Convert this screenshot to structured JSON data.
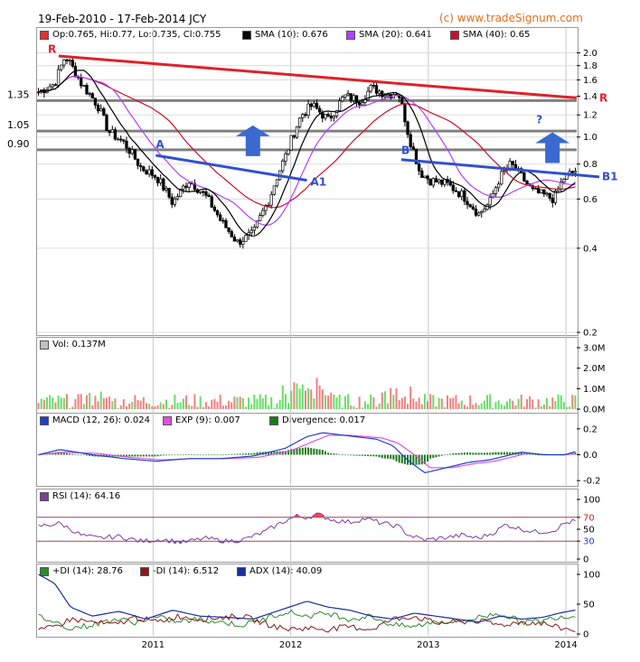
{
  "header": {
    "range_title": "19-Feb-2010 - 17-Feb-2014 JCY",
    "credit": "(c) www.tradeSignum.com"
  },
  "colors": {
    "ohlc_swatch": "#e03030",
    "sma10": "#000000",
    "sma20": "#b040ff",
    "sma40": "#c8102e",
    "volume_up": "#66dd66",
    "volume_down": "#f08080",
    "macd": "#1f3fd0",
    "exp": "#e050e0",
    "divergence": "#1a7a1a",
    "rsi": "#7b3fa0",
    "pdi": "#2e8b2e",
    "mdi": "#8b1a1a",
    "adx": "#1a2e9b",
    "trend_red": "#e0202a",
    "trend_blue": "#3050d0",
    "support_grey": "#808080",
    "arrow_blue": "#3a6ad0"
  },
  "chart_data": [
    {
      "type": "candlestick",
      "panel": "price",
      "legend": {
        "ohlc": "Op:0.765, Hi:0.77, Lo:0.735, Cl:0.755",
        "sma10": "SMA (10): 0.676",
        "sma20": "SMA (20): 0.641",
        "sma40": "SMA (40): 0.65"
      },
      "scale": "log",
      "ylim": [
        0.2,
        2.1
      ],
      "y_ticks": [
        "2.0",
        "1.8",
        "1.6",
        "1.4",
        "1.2",
        "1.0",
        "0.8",
        "0.6",
        "0.4",
        "0.2"
      ],
      "y_tick_values": [
        2.0,
        1.8,
        1.6,
        1.4,
        1.2,
        1.0,
        0.8,
        0.6,
        0.4,
        0.2
      ],
      "x_ticks": [
        "2011",
        "2012",
        "2013",
        "2014"
      ],
      "x_tick_positions": [
        0.215,
        0.47,
        0.725,
        0.98
      ],
      "left_levels": [
        {
          "label": "1.35",
          "value": 1.35
        },
        {
          "label": "1.05",
          "value": 1.05
        },
        {
          "label": "0.90",
          "value": 0.9
        }
      ],
      "trendline_labels": {
        "red_start": "R",
        "red_end": "R",
        "blue1_start": "A",
        "blue1_end": "A1",
        "blue2_start": "B",
        "blue2_end": "B1",
        "question": "?"
      },
      "close_anchors": [
        [
          0.0,
          1.45
        ],
        [
          0.03,
          1.55
        ],
        [
          0.05,
          1.95
        ],
        [
          0.08,
          1.55
        ],
        [
          0.11,
          1.3
        ],
        [
          0.13,
          1.05
        ],
        [
          0.16,
          0.95
        ],
        [
          0.19,
          0.78
        ],
        [
          0.22,
          0.72
        ],
        [
          0.25,
          0.58
        ],
        [
          0.28,
          0.7
        ],
        [
          0.31,
          0.62
        ],
        [
          0.34,
          0.5
        ],
        [
          0.37,
          0.42
        ],
        [
          0.4,
          0.45
        ],
        [
          0.43,
          0.6
        ],
        [
          0.46,
          0.85
        ],
        [
          0.49,
          1.2
        ],
        [
          0.51,
          1.3
        ],
        [
          0.54,
          1.15
        ],
        [
          0.57,
          1.4
        ],
        [
          0.6,
          1.35
        ],
        [
          0.62,
          1.5
        ],
        [
          0.65,
          1.42
        ],
        [
          0.67,
          1.45
        ],
        [
          0.69,
          1.0
        ],
        [
          0.71,
          0.75
        ],
        [
          0.73,
          0.7
        ],
        [
          0.76,
          0.68
        ],
        [
          0.79,
          0.62
        ],
        [
          0.82,
          0.53
        ],
        [
          0.84,
          0.58
        ],
        [
          0.86,
          0.72
        ],
        [
          0.88,
          0.8
        ],
        [
          0.9,
          0.72
        ],
        [
          0.92,
          0.64
        ],
        [
          0.94,
          0.62
        ],
        [
          0.96,
          0.6
        ],
        [
          0.98,
          0.72
        ],
        [
          1.0,
          0.755
        ]
      ]
    },
    {
      "type": "bar",
      "panel": "volume",
      "legend": "Vol: 0.137M",
      "ylim": [
        0,
        3.0
      ],
      "y_ticks": [
        "3.0M",
        "2.0M",
        "1.0M",
        "0.0M"
      ],
      "y_tick_values": [
        3.0,
        2.0,
        1.0,
        0.0
      ]
    },
    {
      "type": "line",
      "panel": "macd",
      "legend": {
        "macd": "MACD (12, 26): 0.024",
        "exp": "EXP (9): 0.007",
        "divergence": "Divergence: 0.017"
      },
      "ylim": [
        -0.22,
        0.22
      ],
      "y_ticks": [
        "0.2",
        "0.0",
        "-0.2"
      ],
      "y_tick_values": [
        0.2,
        0.0,
        -0.2
      ],
      "macd_anchors": [
        [
          0.0,
          0.0
        ],
        [
          0.04,
          0.04
        ],
        [
          0.1,
          0.0
        ],
        [
          0.16,
          -0.03
        ],
        [
          0.22,
          -0.05
        ],
        [
          0.28,
          -0.03
        ],
        [
          0.34,
          -0.03
        ],
        [
          0.4,
          -0.01
        ],
        [
          0.46,
          0.05
        ],
        [
          0.5,
          0.14
        ],
        [
          0.53,
          0.17
        ],
        [
          0.57,
          0.15
        ],
        [
          0.63,
          0.12
        ],
        [
          0.66,
          0.07
        ],
        [
          0.69,
          -0.05
        ],
        [
          0.72,
          -0.14
        ],
        [
          0.76,
          -0.1
        ],
        [
          0.8,
          -0.06
        ],
        [
          0.84,
          -0.04
        ],
        [
          0.88,
          0.0
        ],
        [
          0.9,
          0.02
        ],
        [
          0.94,
          0.0
        ],
        [
          0.98,
          0.0
        ],
        [
          1.0,
          0.024
        ]
      ],
      "exp_anchors": [
        [
          0.0,
          0.0
        ],
        [
          0.05,
          0.02
        ],
        [
          0.11,
          0.01
        ],
        [
          0.17,
          -0.02
        ],
        [
          0.23,
          -0.04
        ],
        [
          0.29,
          -0.03
        ],
        [
          0.35,
          -0.03
        ],
        [
          0.41,
          -0.02
        ],
        [
          0.47,
          0.03
        ],
        [
          0.51,
          0.1
        ],
        [
          0.54,
          0.15
        ],
        [
          0.58,
          0.15
        ],
        [
          0.64,
          0.13
        ],
        [
          0.67,
          0.09
        ],
        [
          0.7,
          0.0
        ],
        [
          0.73,
          -0.1
        ],
        [
          0.77,
          -0.1
        ],
        [
          0.81,
          -0.07
        ],
        [
          0.85,
          -0.05
        ],
        [
          0.89,
          -0.01
        ],
        [
          0.91,
          0.01
        ],
        [
          0.95,
          0.0
        ],
        [
          0.98,
          0.0
        ],
        [
          1.0,
          0.007
        ]
      ]
    },
    {
      "type": "line",
      "panel": "rsi",
      "legend": "RSI (14): 64.16",
      "ylim": [
        0,
        100
      ],
      "y_ticks": [
        "100",
        "70",
        "50",
        "30",
        "0"
      ],
      "y_tick_values": [
        100,
        70,
        50,
        30,
        0
      ],
      "rsi_anchors": [
        [
          0.0,
          55
        ],
        [
          0.04,
          60
        ],
        [
          0.08,
          40
        ],
        [
          0.11,
          35
        ],
        [
          0.15,
          38
        ],
        [
          0.19,
          30
        ],
        [
          0.23,
          33
        ],
        [
          0.27,
          28
        ],
        [
          0.31,
          35
        ],
        [
          0.35,
          30
        ],
        [
          0.38,
          32
        ],
        [
          0.42,
          45
        ],
        [
          0.45,
          60
        ],
        [
          0.48,
          72
        ],
        [
          0.5,
          70
        ],
        [
          0.52,
          75
        ],
        [
          0.55,
          65
        ],
        [
          0.58,
          62
        ],
        [
          0.61,
          68
        ],
        [
          0.64,
          60
        ],
        [
          0.67,
          55
        ],
        [
          0.69,
          40
        ],
        [
          0.72,
          32
        ],
        [
          0.75,
          35
        ],
        [
          0.79,
          40
        ],
        [
          0.82,
          35
        ],
        [
          0.85,
          45
        ],
        [
          0.87,
          58
        ],
        [
          0.9,
          50
        ],
        [
          0.93,
          45
        ],
        [
          0.96,
          48
        ],
        [
          0.98,
          60
        ],
        [
          1.0,
          64.16
        ]
      ]
    },
    {
      "type": "line",
      "panel": "dmi",
      "legend": {
        "pdi": "+DI (14): 28.76",
        "mdi": "-DI (14): 6.512",
        "adx": "ADX (14): 40.09"
      },
      "ylim": [
        0,
        100
      ],
      "y_ticks": [
        "100",
        "50",
        "0"
      ],
      "y_tick_values": [
        100,
        50,
        0
      ],
      "adx_anchors": [
        [
          0.0,
          100
        ],
        [
          0.03,
          85
        ],
        [
          0.06,
          45
        ],
        [
          0.1,
          30
        ],
        [
          0.15,
          38
        ],
        [
          0.2,
          25
        ],
        [
          0.25,
          40
        ],
        [
          0.3,
          30
        ],
        [
          0.35,
          28
        ],
        [
          0.4,
          25
        ],
        [
          0.45,
          40
        ],
        [
          0.5,
          55
        ],
        [
          0.54,
          45
        ],
        [
          0.58,
          40
        ],
        [
          0.62,
          30
        ],
        [
          0.66,
          25
        ],
        [
          0.7,
          35
        ],
        [
          0.74,
          30
        ],
        [
          0.78,
          25
        ],
        [
          0.82,
          20
        ],
        [
          0.86,
          30
        ],
        [
          0.9,
          25
        ],
        [
          0.94,
          28
        ],
        [
          0.97,
          35
        ],
        [
          1.0,
          40.09
        ]
      ],
      "pdi_anchors": [
        [
          0.0,
          30
        ],
        [
          0.03,
          20
        ],
        [
          0.06,
          10
        ],
        [
          0.1,
          15
        ],
        [
          0.14,
          25
        ],
        [
          0.18,
          20
        ],
        [
          0.22,
          28
        ],
        [
          0.26,
          20
        ],
        [
          0.3,
          25
        ],
        [
          0.34,
          20
        ],
        [
          0.38,
          15
        ],
        [
          0.42,
          25
        ],
        [
          0.46,
          38
        ],
        [
          0.5,
          30
        ],
        [
          0.54,
          35
        ],
        [
          0.58,
          25
        ],
        [
          0.62,
          30
        ],
        [
          0.66,
          15
        ],
        [
          0.7,
          12
        ],
        [
          0.74,
          22
        ],
        [
          0.78,
          20
        ],
        [
          0.82,
          28
        ],
        [
          0.86,
          35
        ],
        [
          0.9,
          20
        ],
        [
          0.94,
          22
        ],
        [
          0.97,
          30
        ],
        [
          1.0,
          28.76
        ]
      ],
      "mdi_anchors": [
        [
          0.0,
          5
        ],
        [
          0.03,
          12
        ],
        [
          0.06,
          25
        ],
        [
          0.1,
          20
        ],
        [
          0.14,
          15
        ],
        [
          0.18,
          28
        ],
        [
          0.22,
          20
        ],
        [
          0.26,
          30
        ],
        [
          0.3,
          25
        ],
        [
          0.34,
          28
        ],
        [
          0.38,
          30
        ],
        [
          0.42,
          18
        ],
        [
          0.46,
          8
        ],
        [
          0.5,
          10
        ],
        [
          0.54,
          8
        ],
        [
          0.58,
          12
        ],
        [
          0.62,
          8
        ],
        [
          0.66,
          25
        ],
        [
          0.7,
          30
        ],
        [
          0.74,
          18
        ],
        [
          0.78,
          20
        ],
        [
          0.82,
          22
        ],
        [
          0.86,
          15
        ],
        [
          0.9,
          20
        ],
        [
          0.94,
          18
        ],
        [
          0.97,
          10
        ],
        [
          1.0,
          6.512
        ]
      ]
    }
  ]
}
